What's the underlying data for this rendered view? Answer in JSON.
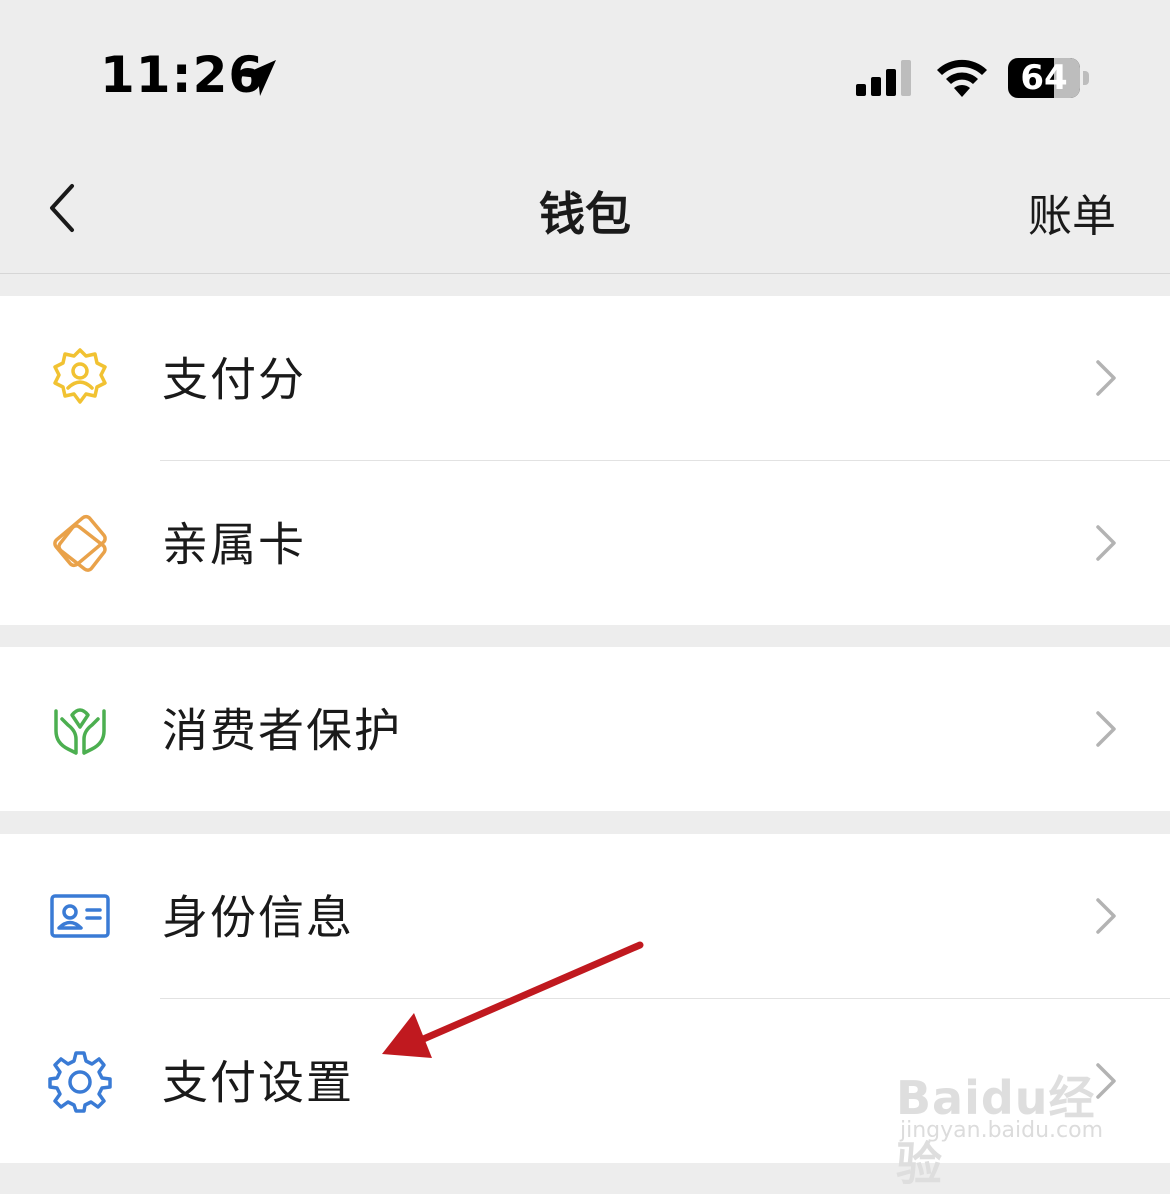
{
  "status_bar": {
    "time": "11:26",
    "battery_level": "64"
  },
  "nav": {
    "title": "钱包",
    "right_action": "账单"
  },
  "groups": [
    {
      "items": [
        {
          "label": "支付分",
          "icon": "pay-score-icon",
          "color": "#f1c232"
        },
        {
          "label": "亲属卡",
          "icon": "family-card-icon",
          "color": "#e9a24a"
        }
      ]
    },
    {
      "items": [
        {
          "label": "消费者保护",
          "icon": "consumer-protection-icon",
          "color": "#4caf50"
        }
      ]
    },
    {
      "items": [
        {
          "label": "身份信息",
          "icon": "id-card-icon",
          "color": "#3a7bd5"
        },
        {
          "label": "支付设置",
          "icon": "gear-icon",
          "color": "#3a7bd5"
        }
      ]
    }
  ],
  "annotation": {
    "color": "#c0191f"
  },
  "watermark": {
    "logo": "Baidu经验",
    "url": "jingyan.baidu.com"
  }
}
